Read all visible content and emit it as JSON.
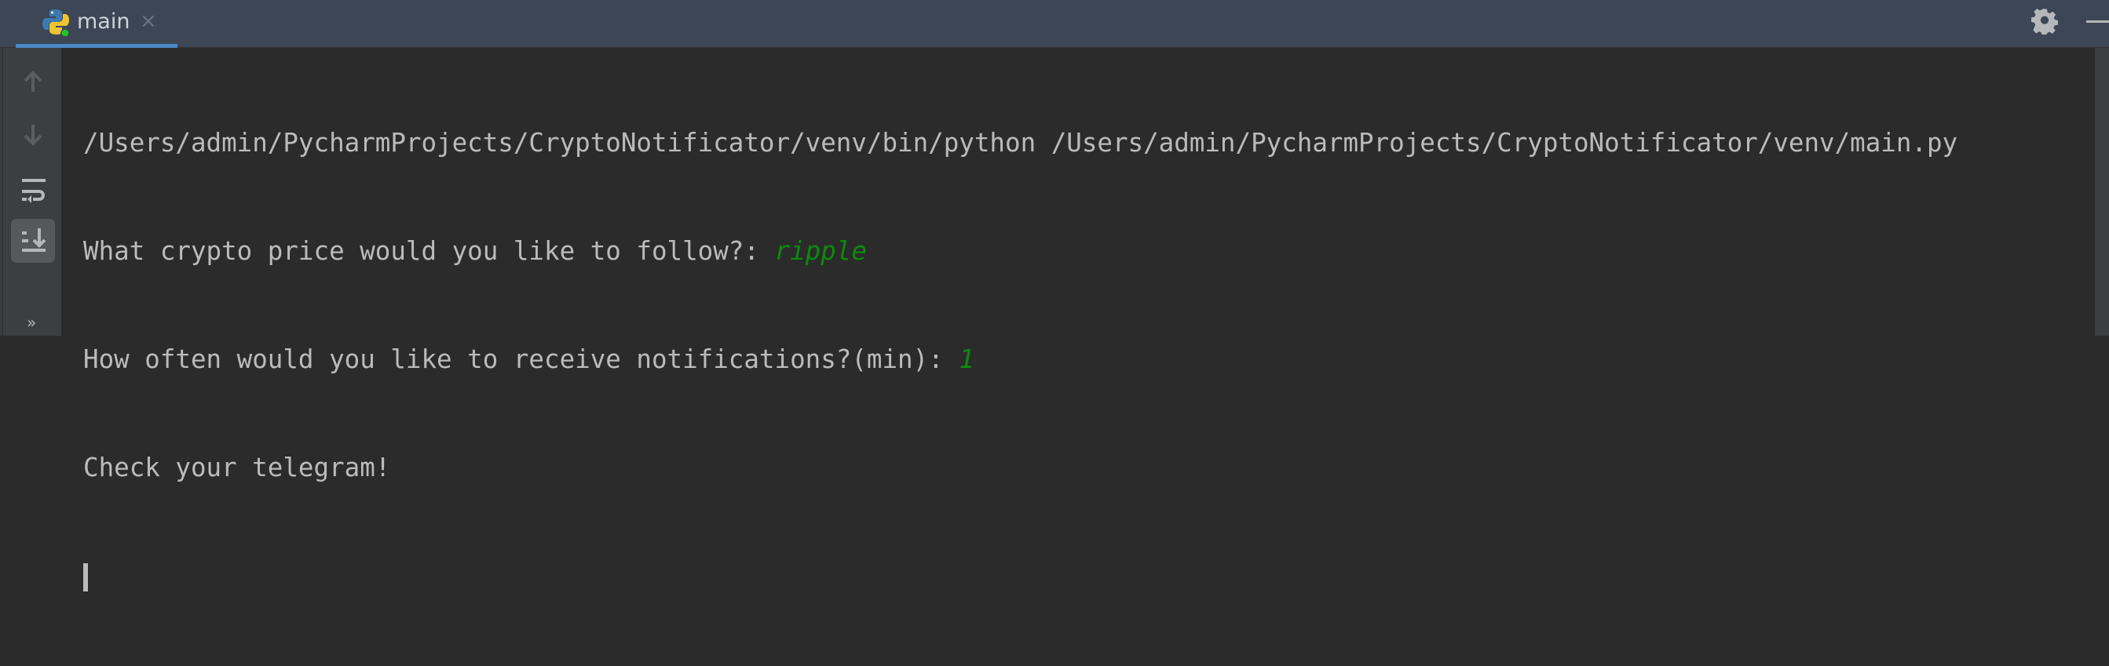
{
  "tab": {
    "label": "main",
    "close": "×",
    "icon": "python-icon",
    "running": true,
    "accent": "#4a88c7"
  },
  "toolbar": {
    "more": "»",
    "buttons": [
      "arrow-up-icon",
      "arrow-down-icon",
      "soft-wrap-icon",
      "scroll-to-end-icon"
    ]
  },
  "console": {
    "lines": [
      {
        "text": "/Users/admin/PycharmProjects/CryptoNotificator/venv/bin/python /Users/admin/PycharmProjects/CryptoNotificator/venv/main.py",
        "input": ""
      },
      {
        "text": "What crypto price would you like to follow?: ",
        "input": "ripple"
      },
      {
        "text": "How often would you like to receive notifications?(min): ",
        "input": "1"
      },
      {
        "text": "Check your telegram!",
        "input": ""
      }
    ],
    "input_color": "#0b8a0b"
  }
}
